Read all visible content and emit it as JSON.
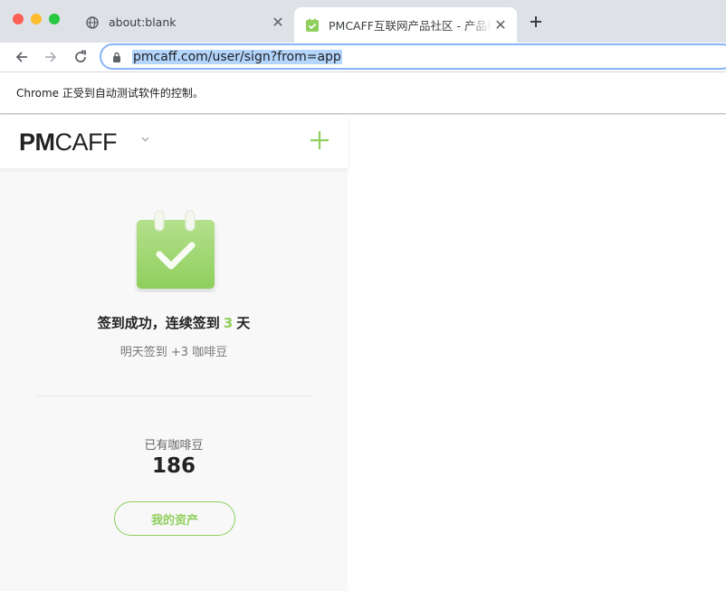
{
  "browser": {
    "tabs": [
      {
        "title": "about:blank",
        "active": false,
        "favicon": "globe-icon"
      },
      {
        "title": "PMCAFF互联网产品社区 - 产品经理",
        "active": true,
        "favicon": "pmcaff-favicon"
      }
    ],
    "url_host": "pmcaff.com",
    "url_path": "/user/sign?from=app",
    "infobar_message": "Chrome 正受到自动测试软件的控制。"
  },
  "app": {
    "logo_bold": "PM",
    "logo_light": "CAFF",
    "sign_title_prefix": "签到成功，连续签到",
    "sign_days": "3",
    "sign_title_suffix": "天",
    "sign_subtitle": "明天签到 +3 咖啡豆",
    "beans_label": "已有咖啡豆",
    "beans_count": "186",
    "assets_button": "我的资产"
  },
  "colors": {
    "accent_green": "#8fcf5d",
    "chrome_frame": "#dee1e6",
    "url_selection": "#b3d4fb"
  }
}
